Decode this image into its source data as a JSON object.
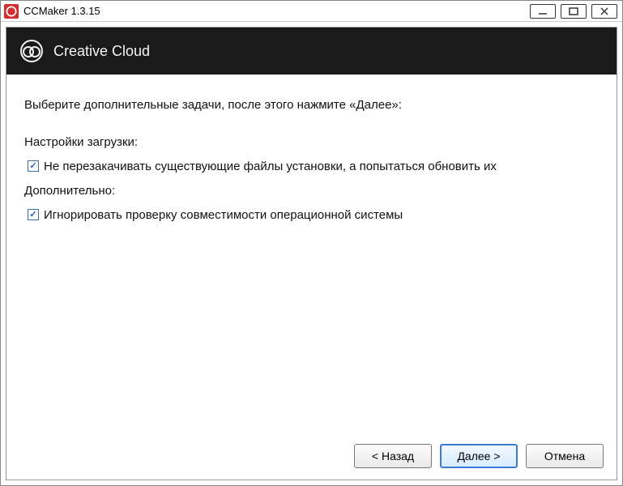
{
  "window": {
    "title": "CCMaker 1.3.15"
  },
  "banner": {
    "title": "Creative Cloud"
  },
  "main": {
    "instruction": "Выберите дополнительные задачи, после этого нажмите «Далее»:",
    "section1_label": "Настройки загрузки:",
    "checkbox1_label": "Не перезакачивать существующие файлы установки, а попытаться обновить их",
    "section2_label": "Дополнительно:",
    "checkbox2_label": "Игнорировать проверку совместимости операционной системы"
  },
  "buttons": {
    "back": "< Назад",
    "next": "Далее >",
    "cancel": "Отмена"
  }
}
